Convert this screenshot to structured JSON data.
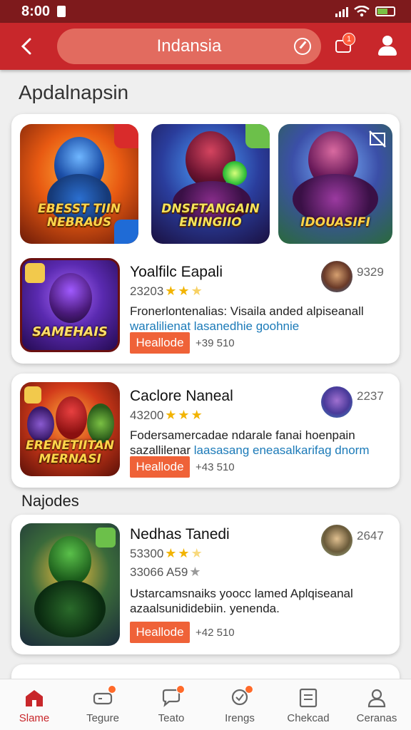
{
  "status_bar": {
    "time": "8:00"
  },
  "app_bar": {
    "search_value": "Indansia",
    "chat_badge": "1"
  },
  "section_main": "Apdalnapsin",
  "section_second": "Najodes",
  "banners": [
    {
      "caption_line1": "EBESST TIIN",
      "caption_line2": "NEBRAUS"
    },
    {
      "caption_line1": "DNSFTANGAIN",
      "caption_line2": "ENINGIIO"
    },
    {
      "caption_line1": "IDOUASIFI",
      "caption_line2": ""
    }
  ],
  "apps": [
    {
      "name": "Yoalfilc Eapali",
      "rating": "23203",
      "stars_full": 2,
      "stars_half": 1,
      "desc_plain": "Fronerlontenalias: Visaila anded alpiseanall",
      "desc_link": "waralilienat lasanedhie goohnie",
      "install": "Heallode",
      "size": "+39 510",
      "count": "9329",
      "thumb_caption": "SAMEHAIS"
    },
    {
      "name": "Caclore Naneal",
      "rating": "43200",
      "stars_full": 3,
      "stars_half": 0,
      "desc_plain": "Fodersamercadae ndarale fanai hoenpain",
      "desc_link_prefix": "sazallilenar ",
      "desc_link": "laasasang eneasalkarifag dnorm",
      "install": "Heallode",
      "size": "+43 510",
      "count": "2237",
      "thumb_caption_line1": "ERENETIITAN",
      "thumb_caption_line2": "MERNASI"
    },
    {
      "name": "Nedhas Tanedi",
      "rating": "53300",
      "stars_full": 2,
      "stars_half": 1,
      "rating2": "33066 A59",
      "desc_plain": "Ustarcamsnaiks yoocc lamed Aplqiseanal",
      "desc_plain2": "azaalsunididebiin. yenenda.",
      "install": "Heallode",
      "size": "+42 510",
      "count": "2647"
    }
  ],
  "nav": [
    {
      "label": "Slame",
      "icon": "store-icon",
      "active": true
    },
    {
      "label": "Tegure",
      "icon": "gamepad-icon",
      "active": false
    },
    {
      "label": "Teato",
      "icon": "chat-icon",
      "active": false
    },
    {
      "label": "Irengs",
      "icon": "message-icon",
      "active": false
    },
    {
      "label": "Chekcad",
      "icon": "checklist-icon",
      "active": false
    },
    {
      "label": "Ceranas",
      "icon": "profile-icon",
      "active": false
    }
  ],
  "colors": {
    "status_bar": "#7e1a1c",
    "app_bar": "#c8272b",
    "install_button": "#ef6238",
    "star": "#f2b400",
    "link": "#1b7ab8"
  }
}
